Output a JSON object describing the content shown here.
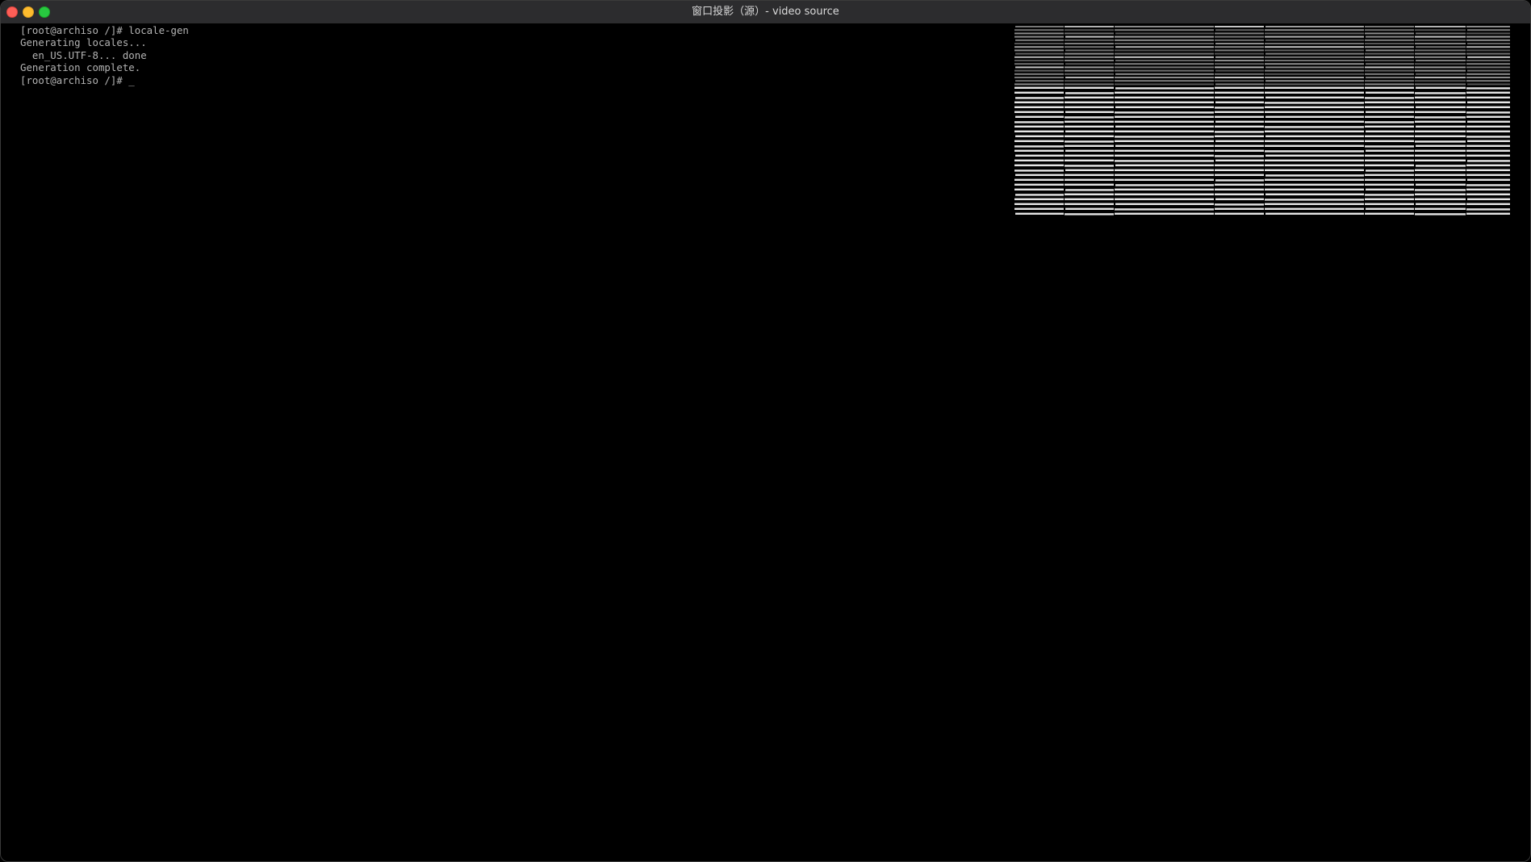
{
  "window": {
    "title": "窗口投影（源）- video source"
  },
  "terminal": {
    "lines": [
      "[root@archiso /]# locale-gen",
      "Generating locales...",
      "  en_US.UTF-8... done",
      "Generation complete.",
      "[root@archiso /]# _"
    ]
  },
  "colors": {
    "titlebar": "#2c2c2e",
    "background": "#000000",
    "terminal_text": "#b3b3b3",
    "close": "#fe5f57",
    "minimize": "#febc2e",
    "zoom": "#28c840"
  }
}
